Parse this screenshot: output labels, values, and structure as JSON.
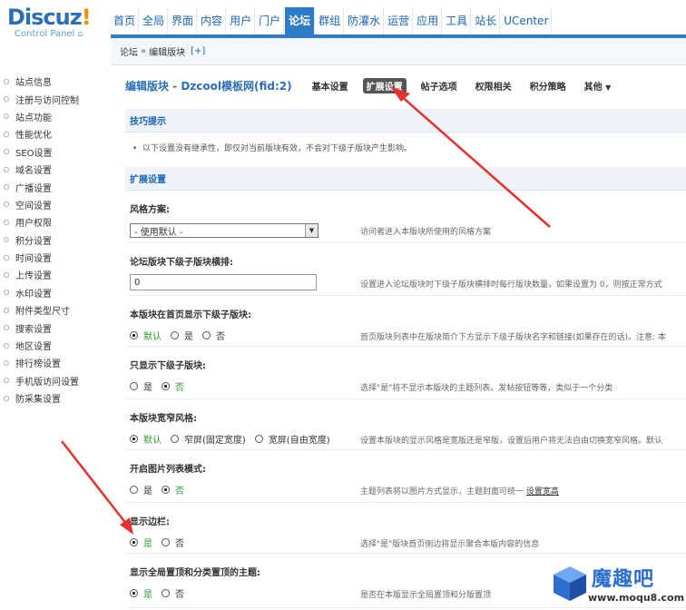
{
  "logo": {
    "brand_main": "Discuz",
    "brand_ex": "!",
    "subtitle": "Control Panel"
  },
  "nav": [
    "首页",
    "全局",
    "界面",
    "内容",
    "用户",
    "门户",
    "论坛",
    "群组",
    "防灌水",
    "运营",
    "应用",
    "工具",
    "站长",
    "UCenter"
  ],
  "nav_active": "论坛",
  "breadcrumb": {
    "root": "论坛",
    "sep": "»",
    "current": "编辑版块",
    "add": "[+]"
  },
  "sidebar": [
    "站点信息",
    "注册与访问控制",
    "站点功能",
    "性能优化",
    "SEO设置",
    "域名设置",
    "广播设置",
    "空间设置",
    "用户权限",
    "积分设置",
    "时间设置",
    "上传设置",
    "水印设置",
    "附件类型尺寸",
    "搜索设置",
    "地区设置",
    "排行榜设置",
    "手机版访问设置",
    "防采集设置"
  ],
  "page": {
    "title": "编辑版块 - Dzcool模板网(fid:2)",
    "tabs": [
      "基本设置",
      "扩展设置",
      "帖子选项",
      "权限相关",
      "积分策略",
      "其他"
    ],
    "active_tab": "扩展设置",
    "more_caret": "▼"
  },
  "tip": {
    "head": "技巧提示",
    "text": "以下设置没有继承性，即仅对当前版块有效，不会对下级子版块产生影响。"
  },
  "ext_head": "扩展设置",
  "settings": [
    {
      "label": "风格方案:",
      "type": "select",
      "value": "- 使用默认 -",
      "desc": "访问者进入本版块所使用的风格方案"
    },
    {
      "label": "论坛版块下级子版块横排:",
      "type": "text",
      "value": "0",
      "desc": "设置进入论坛版块时下级子版块横排时每行版块数量，如果设置为 0，则按正常方式"
    },
    {
      "label": "本版块在首页显示下级子版块:",
      "type": "radio",
      "options": [
        "默认",
        "是",
        "否"
      ],
      "selected": 0,
      "desc": "首页版块列表中在版块简介下方显示下级子版块名字和链接(如果存在的话)。注意: 本"
    },
    {
      "label": "只显示下级子版块:",
      "type": "radio",
      "options": [
        "是",
        "否"
      ],
      "selected": 1,
      "desc": "选择\"是\"将不显示本版块的主题列表、发帖按钮等等，类似于一个分类"
    },
    {
      "label": "本版块宽窄风格:",
      "type": "radio",
      "options": [
        "默认",
        "窄屏(固定宽度)",
        "宽屏(自由宽度)"
      ],
      "selected": 0,
      "desc": "设置本版块的显示风格是宽版还是窄版，设置后用户将无法自由切换宽窄风格。默认"
    },
    {
      "label": "开启图片列表模式:",
      "type": "radio",
      "options": [
        "是",
        "否"
      ],
      "selected": 1,
      "desc": "主题列表将以图片方式显示，主题封面可统一",
      "desc_link": "设置宽高"
    },
    {
      "label": "显示边栏:",
      "type": "radio",
      "options": [
        "是",
        "否"
      ],
      "selected": 0,
      "desc": "选择\"是\"版块首页侧边将显示聚合本版内容的信息"
    },
    {
      "label": "显示全局置顶和分类置顶的主题:",
      "type": "radio",
      "options": [
        "是",
        "否"
      ],
      "selected": 0,
      "desc": "是否在本版显示全局置顶和分版置顶"
    }
  ],
  "watermark": {
    "name": "魔趣吧",
    "url": "www.moqu8.com"
  },
  "colors": {
    "accent": "#2e7cc8",
    "link": "#1a65b4",
    "selected": "#2e9a2e",
    "arrow": "#e53030"
  }
}
